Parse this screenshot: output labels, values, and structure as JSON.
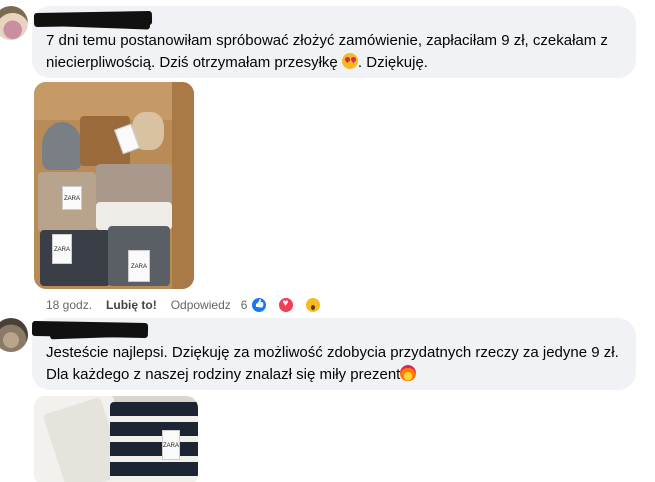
{
  "comments": [
    {
      "text_line1": "7 dni temu postanowiłam spróbować złożyć zamówienie, zapłaciłam 9 zł, czekałam z",
      "text_line2": "niecierpliwością. Dziś otrzymałam przesyłkę",
      "text_line2_end": ". Dziękuję.",
      "emoji": "heart-eyes-icon",
      "time": "18 godz.",
      "like_label": "Lubię to!",
      "reply_label": "Odpowiedz",
      "reaction_count": "6",
      "reactions": [
        "like-icon",
        "love-icon",
        "wow-icon"
      ],
      "photo_tags": [
        "ZARA",
        "ZARA",
        "ZARA"
      ]
    },
    {
      "text_line1": "Jesteście najlepsi. Dziękuję za możliwość zdobycia przydatnych rzeczy za jedyne 9 zł.",
      "text_line2": "Dla każdego z naszej rodziny znalazł się miły prezent",
      "emoji": "fire-icon",
      "photo_tags": [
        "ZARA"
      ]
    }
  ],
  "colors": {
    "bubble": "#f0f2f5",
    "like": "#1877f2",
    "love": "#f33e58",
    "wow": "#f7b924"
  }
}
